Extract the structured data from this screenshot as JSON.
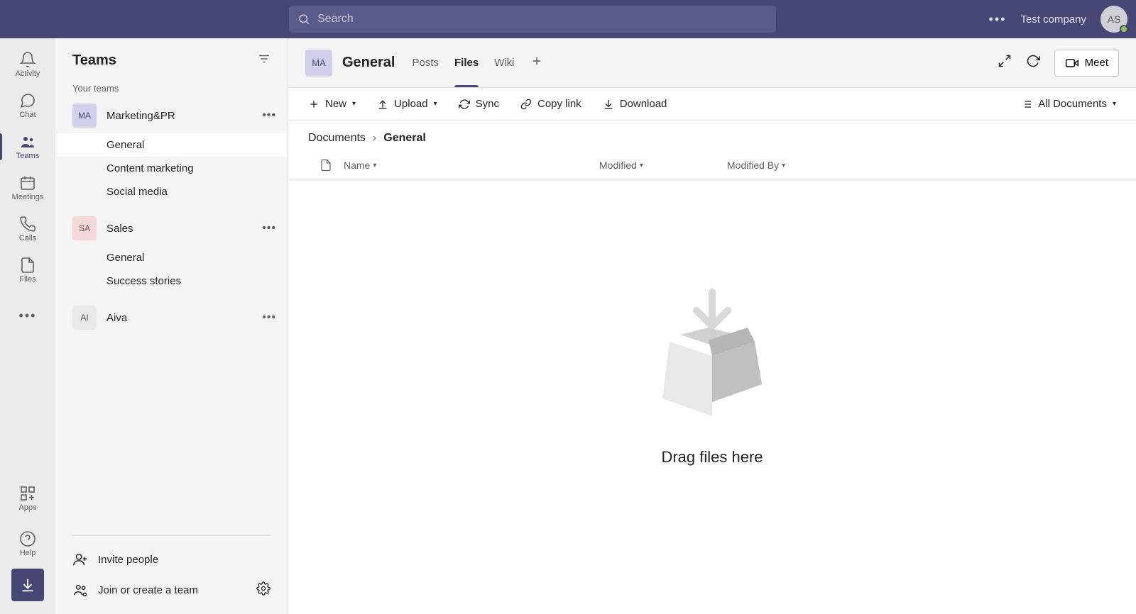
{
  "topbar": {
    "search_placeholder": "Search",
    "company": "Test company",
    "avatar_initials": "AS"
  },
  "rail": {
    "activity": "Activity",
    "chat": "Chat",
    "teams": "Teams",
    "meetings": "Meetings",
    "calls": "Calls",
    "files": "Files",
    "apps": "Apps",
    "help": "Help"
  },
  "sidebar": {
    "title": "Teams",
    "your_teams": "Your teams",
    "teams": [
      {
        "initials": "MA",
        "name": "Marketing&PR",
        "channels": [
          "General",
          "Content marketing",
          "Social media"
        ],
        "avatar_class": ""
      },
      {
        "initials": "SA",
        "name": "Sales",
        "channels": [
          "General",
          "Success stories"
        ],
        "avatar_class": "sa"
      },
      {
        "initials": "AI",
        "name": "Aiva",
        "channels": [],
        "avatar_class": "ai"
      }
    ],
    "invite": "Invite people",
    "join": "Join or create a team"
  },
  "header": {
    "avatar": "MA",
    "title": "General",
    "tabs": {
      "posts": "Posts",
      "files": "Files",
      "wiki": "Wiki"
    },
    "meet": "Meet"
  },
  "toolbar": {
    "new": "New",
    "upload": "Upload",
    "sync": "Sync",
    "copy_link": "Copy link",
    "download": "Download",
    "all_docs": "All Documents"
  },
  "breadcrumb": {
    "root": "Documents",
    "current": "General"
  },
  "columns": {
    "name": "Name",
    "modified": "Modified",
    "modified_by": "Modified By"
  },
  "empty": {
    "drag": "Drag files here"
  }
}
